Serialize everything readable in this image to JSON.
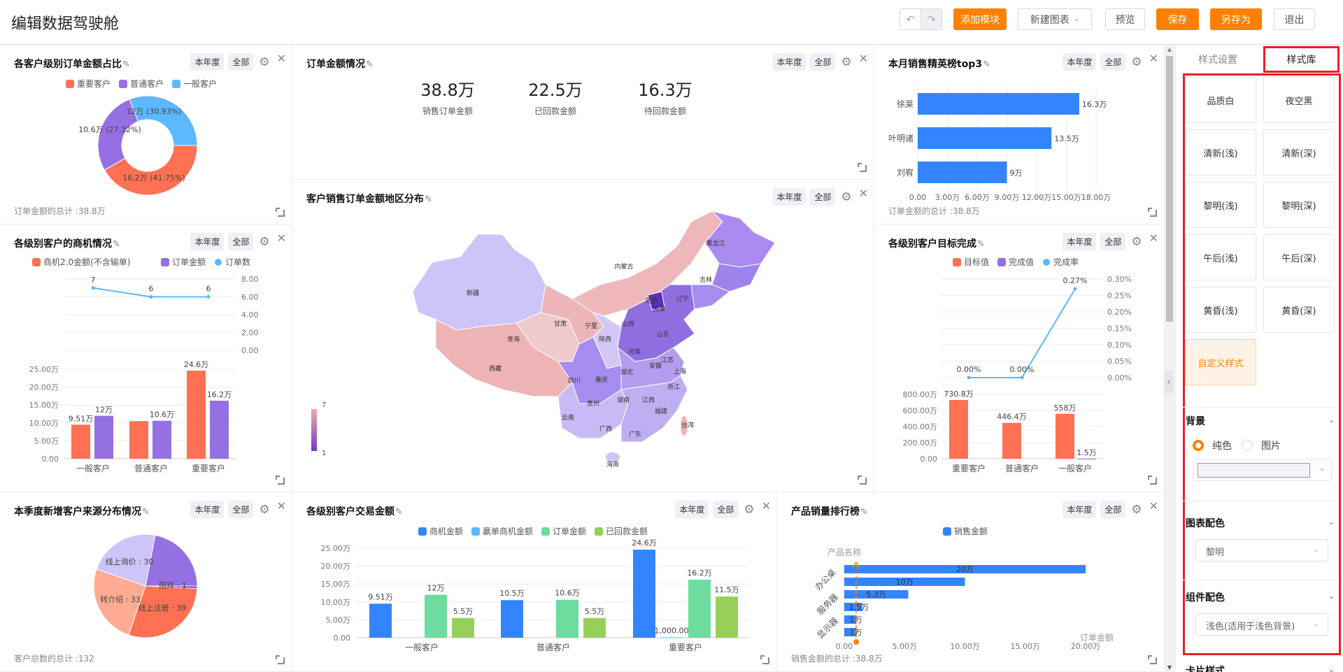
{
  "header": {
    "title": "编辑数据驾驶舱",
    "buttons": {
      "add_module": "添加模块",
      "new_chart": "新建图表",
      "preview": "预览",
      "save": "保存",
      "save_as": "另存为",
      "exit": "退出"
    }
  },
  "common": {
    "period": "本年度",
    "scope": "全部"
  },
  "panels": {
    "order_share": {
      "title": "各客户级别订单金额占比",
      "footer": "订单金额的总计 :38.8万"
    },
    "order_summary": {
      "title": "订单金额情况",
      "stats": [
        {
          "value": "38.8万",
          "label": "销售订单金额"
        },
        {
          "value": "22.5万",
          "label": "已回款金额"
        },
        {
          "value": "16.3万",
          "label": "待回款金额"
        }
      ]
    },
    "region_map": {
      "title": "客户销售订单金额地区分布"
    },
    "top3": {
      "title": "本月销售精英榜top3",
      "footer": "订单金额的总计 :38.8万"
    },
    "opportunity": {
      "title": "各级别客户的商机情况"
    },
    "target": {
      "title": "各级别客户目标完成"
    },
    "source": {
      "title": "本季度新增客户来源分布情况",
      "footer": "客户总数的总计 :132"
    },
    "transaction": {
      "title": "各级别客户交易金额"
    },
    "product_rank": {
      "title": "产品销量排行榜",
      "footer": "销售金额的总计 :38.8万"
    }
  },
  "sidebar": {
    "tabs": [
      "样式设置",
      "样式库"
    ],
    "active_tab": "样式库",
    "themes": [
      "品质白",
      "夜空黑",
      "清新(浅)",
      "清新(深)",
      "黎明(浅)",
      "黎明(深)",
      "午后(浅)",
      "午后(深)",
      "黄昏(浅)",
      "黄昏(深)",
      "自定义样式"
    ],
    "background": {
      "title": "背景",
      "options": [
        "纯色",
        "图片"
      ],
      "selected": "纯色"
    },
    "chart_color": {
      "title": "图表配色",
      "value": "黎明"
    },
    "component_color": {
      "title": "组件配色",
      "value": "浅色(适用于浅色背景)"
    },
    "card_style": {
      "title": "卡片样式"
    }
  },
  "colors": {
    "accent": "#ff8000",
    "highlight": "#e8202a",
    "orange": "#ff7152",
    "purple": "#9570e3",
    "light_blue": "#5cb8ff",
    "blue": "#3385ff",
    "green": "#6ddc9e",
    "lime": "#96d05a"
  },
  "chart_data": [
    {
      "id": "order_share",
      "type": "pie",
      "title": "各客户级别订单金额占比",
      "legend": [
        "重要客户",
        "普通客户",
        "一般客户"
      ],
      "series": [
        {
          "name": "重要客户",
          "value": 16.2,
          "label": "16.2万 (41.75%)",
          "color": "#ff7152"
        },
        {
          "name": "普通客户",
          "value": 10.6,
          "label": "10.6万 (27.32%)",
          "color": "#9570e3"
        },
        {
          "name": "一般客户",
          "value": 12,
          "label": "12万 (30.93%)",
          "color": "#5cb8ff"
        }
      ]
    },
    {
      "id": "top3",
      "type": "bar",
      "orientation": "horizontal",
      "title": "本月销售精英榜top3",
      "categories": [
        "徐莱",
        "叶明诸",
        "刘宥"
      ],
      "values": [
        16.3,
        13.5,
        9
      ],
      "labels": [
        "16.3万",
        "13.5万",
        "9万"
      ],
      "xlim": [
        0,
        18
      ],
      "xticks": [
        "0.00",
        "3.00万",
        "6.00万",
        "9.00万",
        "12.00万",
        "15.00万",
        "18.00万"
      ],
      "color": "#3385ff"
    },
    {
      "id": "opportunity",
      "type": "bar",
      "title": "各级别客户的商机情况",
      "categories": [
        "一般客户",
        "普通客户",
        "重要客户"
      ],
      "legend": [
        "商机2.0金额(不含输单)",
        "订单金额",
        "订单数"
      ],
      "series": [
        {
          "name": "商机2.0金额(不含输单)",
          "type": "bar",
          "values": [
            9.51,
            10.5,
            24.6
          ],
          "labels": [
            "9.51万",
            null,
            "24.6万"
          ],
          "color": "#ff7152"
        },
        {
          "name": "订单金额",
          "type": "bar",
          "values": [
            12,
            10.6,
            16.2
          ],
          "labels": [
            "12万",
            "10.6万",
            "16.2万"
          ],
          "color": "#9570e3"
        },
        {
          "name": "订单数",
          "type": "line",
          "values": [
            7,
            6,
            6
          ],
          "labels": [
            "7",
            "6",
            "6"
          ],
          "color": "#5cb8ff"
        }
      ],
      "ylim": [
        0,
        25
      ],
      "yticks": [
        "0.00",
        "5.00万",
        "10.00万",
        "15.00万",
        "20.00万",
        "25.00万"
      ],
      "ylim_line": [
        0,
        8
      ],
      "yticks_line": [
        "0.00",
        "2.00",
        "4.00",
        "6.00",
        "8.00"
      ]
    },
    {
      "id": "target",
      "type": "bar",
      "title": "各级别客户目标完成",
      "categories": [
        "重要客户",
        "普通客户",
        "一般客户"
      ],
      "legend": [
        "目标值",
        "完成值",
        "完成率"
      ],
      "series": [
        {
          "name": "目标值",
          "type": "bar",
          "values": [
            730.8,
            446.4,
            558
          ],
          "labels": [
            "730.8万",
            "446.4万",
            "558万"
          ],
          "color": "#ff7152"
        },
        {
          "name": "完成值",
          "type": "bar",
          "values": [
            0,
            0,
            1.5
          ],
          "labels": [
            null,
            null,
            "1.5万"
          ],
          "color": "#9570e3"
        },
        {
          "name": "完成率",
          "type": "line",
          "values": [
            0,
            0,
            0.27
          ],
          "labels": [
            "0.00%",
            "0.00%",
            "0.27%"
          ],
          "color": "#5cb8ff"
        }
      ],
      "ylim": [
        0,
        800
      ],
      "yticks": [
        "0.00",
        "200.00万",
        "400.00万",
        "600.00万",
        "800.00万"
      ],
      "ylim_line": [
        0,
        0.3
      ],
      "yticks_line": [
        "0.00%",
        "0.05%",
        "0.10%",
        "0.15%",
        "0.20%",
        "0.25%",
        "0.30%"
      ]
    },
    {
      "id": "source",
      "type": "pie",
      "title": "本季度新增客户来源分布情况",
      "series": [
        {
          "name": "陌拜",
          "value": 1,
          "label": "陌拜 : 1",
          "color": "#6a3fc9"
        },
        {
          "name": "线上注册",
          "value": 39,
          "label": "线上注册 : 39",
          "color": "#ff7152"
        },
        {
          "name": "转介绍",
          "value": 33,
          "label": "转介绍 : 33",
          "color": "#ffab94"
        },
        {
          "name": "线上询价",
          "value": 30,
          "label": "线上询价 : 30",
          "color": "#cdc4f7"
        },
        {
          "name": "",
          "value": 29,
          "label": null,
          "color": "#9570e3"
        }
      ]
    },
    {
      "id": "transaction",
      "type": "bar",
      "title": "各级别客户交易金额",
      "categories": [
        "一般客户",
        "普通客户",
        "重要客户"
      ],
      "legend": [
        "商机金额",
        "赢单商机金额",
        "订单金额",
        "已回款金额"
      ],
      "series": [
        {
          "name": "商机金额",
          "values": [
            9.51,
            10.5,
            24.6
          ],
          "labels": [
            "9.51万",
            "10.5万",
            "24.6万"
          ],
          "color": "#3385ff"
        },
        {
          "name": "赢单商机金额",
          "values": [
            0,
            0,
            0.1
          ],
          "labels": [
            null,
            null,
            "1,000.00"
          ],
          "color": "#5cb8ff"
        },
        {
          "name": "订单金额",
          "values": [
            12,
            10.6,
            16.2
          ],
          "labels": [
            "12万",
            "10.6万",
            "16.2万"
          ],
          "color": "#6ddc9e"
        },
        {
          "name": "已回款金额",
          "values": [
            5.5,
            5.5,
            11.5
          ],
          "labels": [
            "5.5万",
            "5.5万",
            "11.5万"
          ],
          "color": "#96d05a"
        }
      ],
      "ylim": [
        0,
        25
      ],
      "yticks": [
        "0.00",
        "5.00万",
        "10.00万",
        "15.00万",
        "20.00万",
        "25.00万"
      ]
    },
    {
      "id": "product_rank",
      "type": "bar",
      "orientation": "horizontal",
      "title": "产品销量排行榜",
      "legend": [
        "销售金额"
      ],
      "ylabel": "产品名称",
      "xlabel": "订单金额",
      "ytick_labels": [
        "办公桌",
        "服务器",
        "显示器"
      ],
      "values": [
        20,
        10,
        5.3,
        1.5,
        1,
        1
      ],
      "labels": [
        "20万",
        "10万",
        "5.3万",
        "1.5万",
        "1万",
        "1万"
      ],
      "xlim": [
        0,
        20
      ],
      "xticks": [
        "0.00",
        "5.00万",
        "10.00万",
        "15.00万",
        "20.00万"
      ],
      "color": "#3385ff",
      "marker_color": "#ff8000"
    },
    {
      "id": "region_map",
      "type": "map",
      "title": "客户销售订单金额地区分布",
      "visual_map": {
        "min": 1,
        "max": 7,
        "min_label": "1",
        "max_label": "7"
      },
      "regions": [
        "黑龙江",
        "吉林",
        "辽宁",
        "内蒙古",
        "新疆",
        "北京",
        "天津",
        "山西",
        "山东",
        "甘肃",
        "宁夏",
        "陕西",
        "青海",
        "西藏",
        "四川",
        "重庆",
        "湖北",
        "河南",
        "江苏",
        "安徽",
        "上海",
        "浙江",
        "湖南",
        "江西",
        "福建",
        "贵州",
        "云南",
        "广西",
        "广东",
        "台湾",
        "海南"
      ]
    }
  ]
}
